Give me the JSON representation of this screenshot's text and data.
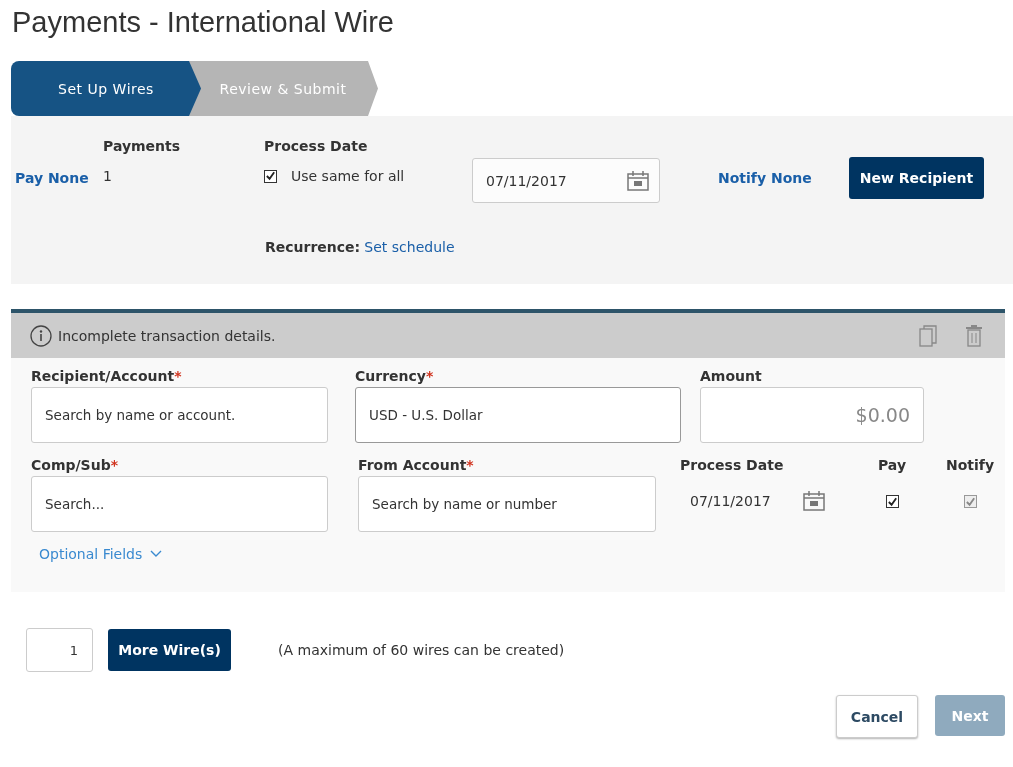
{
  "page_title": "Payments - International Wire",
  "steps": [
    {
      "label": "Set Up Wires",
      "selected": true
    },
    {
      "label": "Review & Submit",
      "selected": false
    }
  ],
  "summary": {
    "pay_link": "Pay None",
    "payments_label": "Payments",
    "payments_count": "1",
    "process_date_label": "Process Date",
    "use_same": {
      "label": "Use same for all",
      "checked": true
    },
    "date_value": "07/11/2017",
    "notify_link": "Notify None",
    "new_recipient_button": "New Recipient",
    "recurrence_label": "Recurrence:",
    "recurrence_link": "Set schedule"
  },
  "wire": {
    "status_message": "Incomplete transaction details.",
    "row_1": [
      {
        "label": "Recipient/Account",
        "required_mark": "*",
        "placeholder": "Search by name or account."
      },
      {
        "label": "Currency",
        "required_mark": "*",
        "value": "USD - U.S. Dollar"
      },
      {
        "label": "Amount",
        "placeholder": "$0.00"
      }
    ],
    "row_2": [
      {
        "label": "Comp/Sub",
        "required_mark": "*",
        "placeholder": "Search..."
      },
      {
        "label": "From Account",
        "required_mark": "*",
        "placeholder": "Search by name or number"
      }
    ],
    "process_date_label": "Process Date",
    "process_date": "07/11/2017",
    "pay": {
      "label": "Pay",
      "checked": true,
      "disabled": false
    },
    "notify": {
      "label": "Notify",
      "checked": true,
      "disabled": true
    },
    "optional_fields_link": "Optional Fields"
  },
  "footer": {
    "wire_count": "1",
    "more_button": "More Wire(s)",
    "note": "(A maximum of 60 wires can be created)",
    "cancel_button": "Cancel",
    "next_button": {
      "label": "Next",
      "disabled": true
    }
  }
}
